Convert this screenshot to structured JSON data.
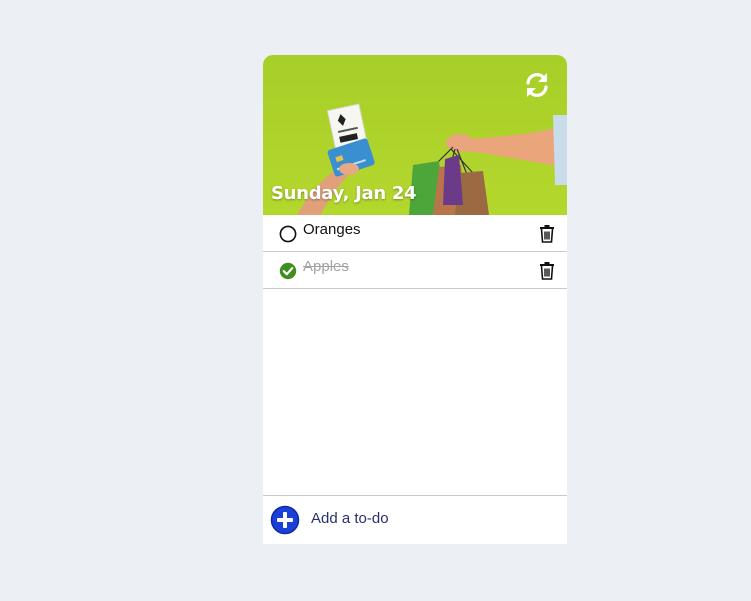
{
  "header": {
    "date": "Sunday, Jan 24",
    "refresh_icon": "refresh-icon",
    "image": "shopping-hands-photo",
    "accent": "#b2d52c"
  },
  "todos": [
    {
      "label": "Oranges",
      "done": false
    },
    {
      "label": "Apples",
      "done": true
    }
  ],
  "footer": {
    "add_label": "Add a to-do",
    "add_icon": "plus-circle-icon",
    "add_color": "#1c3fd8"
  }
}
